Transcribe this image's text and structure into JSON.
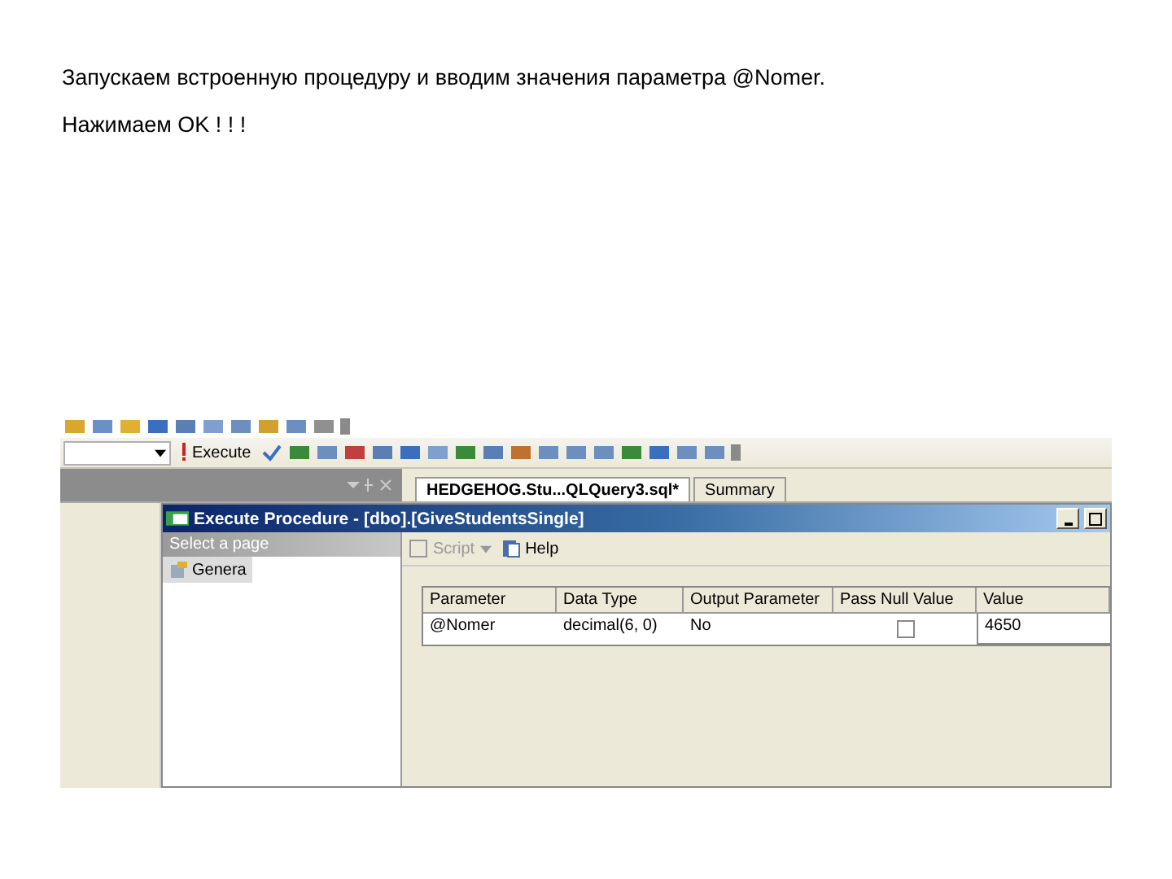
{
  "instruction_lines": [
    "Запускаем встроенную процедуру и вводим значения параметра @Nomer.",
    "Нажимаем OK ! ! !"
  ],
  "toolbar": {
    "execute_label": "Execute"
  },
  "document_tabs": [
    {
      "label": "HEDGEHOG.Stu...QLQuery3.sql*",
      "selected": true
    },
    {
      "label": "Summary",
      "selected": false
    }
  ],
  "dialog": {
    "title": "Execute Procedure - [dbo].[GiveStudentsSingle]",
    "page_header": "Select a page",
    "pages": [
      {
        "label": "Genera",
        "selected": true
      }
    ],
    "toolbar": [
      {
        "label": "Script",
        "kind": "dropdown"
      },
      {
        "label": "Help",
        "kind": "button"
      }
    ],
    "columns": [
      "Parameter",
      "Data Type",
      "Output Parameter",
      "Pass Null Value",
      "Value"
    ],
    "rows": [
      {
        "parameter": "@Nomer",
        "data_type": "decimal(6, 0)",
        "output_parameter": "No",
        "pass_null_value": false,
        "value": "4650"
      }
    ]
  }
}
